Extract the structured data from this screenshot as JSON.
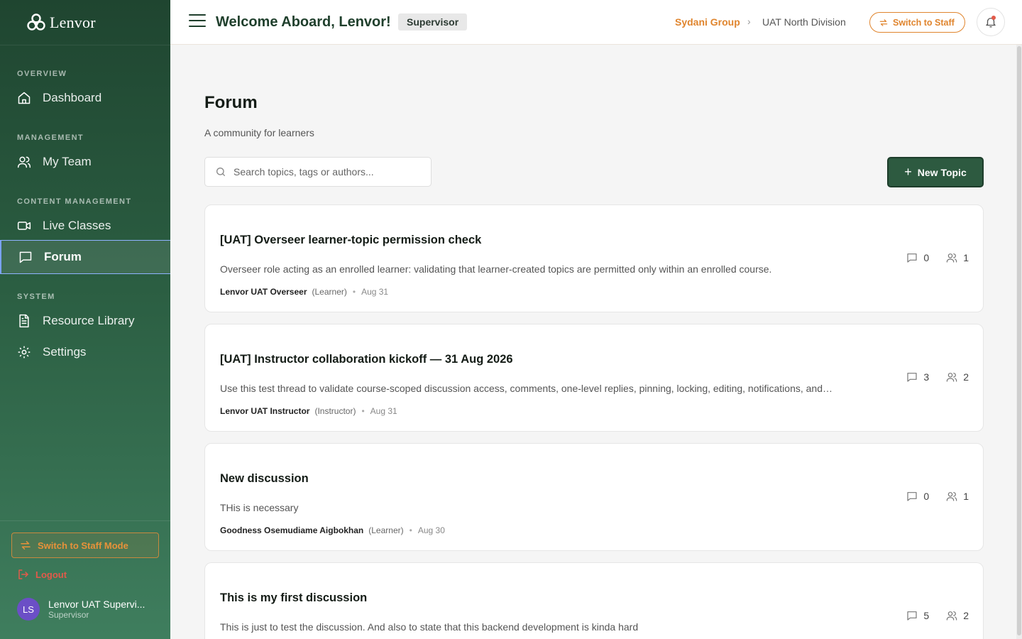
{
  "brand": {
    "name": "Lenvor"
  },
  "sidebar": {
    "sections": {
      "overview": "OVERVIEW",
      "management": "MANAGEMENT",
      "content": "CONTENT MANAGEMENT",
      "system": "SYSTEM"
    },
    "items": {
      "dashboard": "Dashboard",
      "my_team": "My Team",
      "live_classes": "Live Classes",
      "forum": "Forum",
      "resource_library": "Resource Library",
      "settings": "Settings"
    },
    "active_item": "forum",
    "switch_staff_mode": "Switch to Staff Mode",
    "logout": "Logout",
    "user": {
      "initials": "LS",
      "name": "Lenvor UAT Supervi...",
      "role": "Supervisor"
    }
  },
  "header": {
    "welcome": "Welcome Aboard, Lenvor!",
    "role_badge": "Supervisor",
    "breadcrumb": {
      "org": "Sydani Group",
      "division": "UAT North Division"
    },
    "switch_staff": "Switch to Staff"
  },
  "page": {
    "title": "Forum",
    "subtitle": "A community for learners",
    "search_placeholder": "Search topics, tags or authors...",
    "new_topic": "New Topic"
  },
  "topics": [
    {
      "title": "[UAT] Overseer learner-topic permission check",
      "excerpt": "Overseer role acting as an enrolled learner: validating that learner-created topics are permitted only within an enrolled course.",
      "author": "Lenvor UAT Overseer",
      "role": "(Learner)",
      "date": "Aug 31",
      "comments": "0",
      "participants": "1"
    },
    {
      "title": "[UAT] Instructor collaboration kickoff — 31 Aug 2026",
      "excerpt": "Use this test thread to validate course-scoped discussion access, comments, one-level replies, pinning, locking, editing, notifications, and…",
      "author": "Lenvor UAT Instructor",
      "role": "(Instructor)",
      "date": "Aug 31",
      "comments": "3",
      "participants": "2"
    },
    {
      "title": "New discussion",
      "excerpt": "THis is necessary",
      "author": "Goodness Osemudiame Aigbokhan",
      "role": "(Learner)",
      "date": "Aug 30",
      "comments": "0",
      "participants": "1"
    },
    {
      "title": "This is my first discussion",
      "excerpt": "This is just to test the discussion. And also to state that this backend development is kinda hard",
      "author": "",
      "role": "",
      "date": "",
      "comments": "5",
      "participants": "2"
    }
  ],
  "colors": {
    "sidebar_top": "#1f4530",
    "sidebar_bottom": "#3f7e5e",
    "accent_orange": "#e0852e",
    "primary_green": "#2d5a40",
    "avatar": "#6b4fc6"
  }
}
